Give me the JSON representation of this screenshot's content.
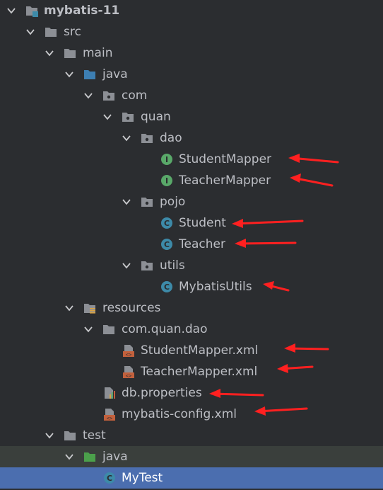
{
  "tree": {
    "project": "mybatis-11",
    "src": "src",
    "main": "main",
    "java": "java",
    "com": "com",
    "quan": "quan",
    "dao": "dao",
    "student_mapper": "StudentMapper",
    "teacher_mapper": "TeacherMapper",
    "pojo": "pojo",
    "student": "Student",
    "teacher": "Teacher",
    "utils": "utils",
    "mybatis_utils": "MybatisUtils",
    "resources": "resources",
    "com_quan_dao": "com.quan.dao",
    "student_mapper_xml": "StudentMapper.xml",
    "teacher_mapper_xml": "TeacherMapper.xml",
    "db_properties": "db.properties",
    "mybatis_config_xml": "mybatis-config.xml",
    "test": "test",
    "test_java": "java",
    "my_test": "MyTest"
  },
  "colors": {
    "background": "#2b2d30",
    "selection": "#4b6eaf",
    "interface_icon": "#59a869",
    "class_icon": "#3d8aa8",
    "folder": "#8c8f95",
    "source_root": "#3d7fb3",
    "test_root": "#4ba04b",
    "annotation_arrow": "#ff2020"
  }
}
